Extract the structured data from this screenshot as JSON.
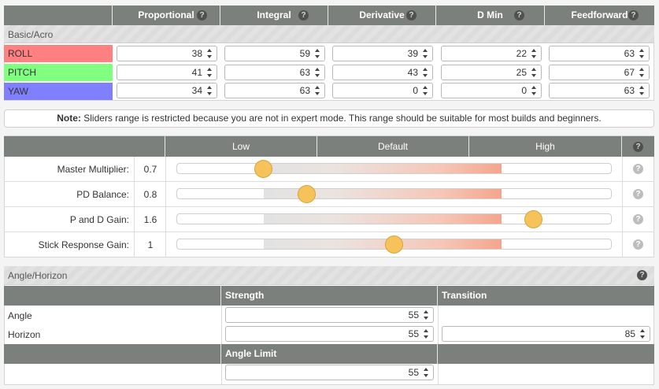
{
  "pid_table": {
    "columns": [
      {
        "label": "Proportional"
      },
      {
        "label": "Integral"
      },
      {
        "label": "Derivative"
      },
      {
        "label": "D Min"
      },
      {
        "label": "Feedforward"
      }
    ],
    "help_glyph": "?",
    "section_label": "Basic/Acro",
    "rows": [
      {
        "label": "ROLL",
        "color": "#ff8080",
        "values": [
          "38",
          "59",
          "39",
          "22",
          "63"
        ]
      },
      {
        "label": "PITCH",
        "color": "#80ff80",
        "values": [
          "41",
          "63",
          "43",
          "25",
          "67"
        ]
      },
      {
        "label": "YAW",
        "color": "#8080ff",
        "values": [
          "34",
          "63",
          "0",
          "0",
          "63"
        ]
      }
    ]
  },
  "note": {
    "prefix": "Note:",
    "text": " Sliders range is restricted because you are not in expert mode. This range should be suitable for most builds and beginners."
  },
  "sliders": {
    "header": {
      "low": "Low",
      "default": "Default",
      "high": "High"
    },
    "items": [
      {
        "label": "Master Multiplier:",
        "value": "0.7",
        "position": 0.2
      },
      {
        "label": "PD Balance:",
        "value": "0.8",
        "position": 0.3
      },
      {
        "label": "P and D Gain:",
        "value": "1.6",
        "position": 0.82
      },
      {
        "label": "Stick Response Gain:",
        "value": "1",
        "position": 0.5
      }
    ],
    "accent_color": "#f6c25a"
  },
  "angle_horizon": {
    "title": "Angle/Horizon",
    "strength_header": "Strength",
    "transition_header": "Transition",
    "angle_label": "Angle",
    "horizon_label": "Horizon",
    "angle_strength": "55",
    "horizon_strength": "55",
    "horizon_transition": "85",
    "angle_limit_header": "Angle Limit",
    "angle_limit": "55"
  }
}
